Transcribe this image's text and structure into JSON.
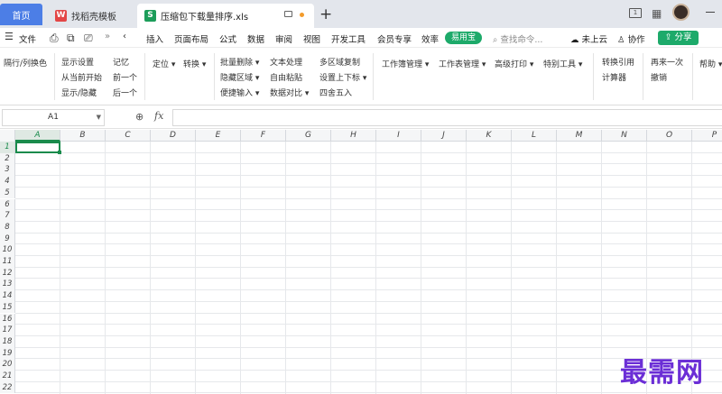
{
  "titlebar": {
    "tabs": [
      {
        "label": "首页"
      },
      {
        "label": "找稻壳模板"
      },
      {
        "label": "压缩包下载量排序.xls"
      }
    ],
    "new_tab": "+"
  },
  "menu": {
    "file": "文件",
    "items": [
      "插入",
      "页面布局",
      "公式",
      "数据",
      "审阅",
      "视图",
      "开发工具",
      "会员专享",
      "效率"
    ],
    "badge": "易用宝",
    "search_placeholder": "查找命令...",
    "cloud": "未上云",
    "collab": "协作",
    "share": "分享"
  },
  "ribbon": {
    "col1": [
      "隔行/列换色"
    ],
    "col2": [
      "显示设置",
      "从当前开始",
      "显示/隐藏"
    ],
    "col3": [
      "记忆",
      "前一个",
      "后一个"
    ],
    "col4": [
      "定位",
      "转换"
    ],
    "col5": [
      "批量删除",
      "隐藏区域",
      "便捷输入"
    ],
    "col6": [
      "文本处理",
      "自由粘贴",
      "数据对比"
    ],
    "col7": [
      "多区域复制",
      "设置上下标",
      "四舍五入"
    ],
    "col8": [
      "工作簿管理",
      "工作表管理",
      "高级打印",
      "特别工具"
    ],
    "col9": [
      "转换引用",
      "计算器"
    ],
    "col10": [
      "再来一次",
      "撤销"
    ],
    "col11": [
      "帮助"
    ]
  },
  "formula": {
    "namebox": "A1",
    "fx": "fx",
    "value": ""
  },
  "grid": {
    "columns": [
      "A",
      "B",
      "C",
      "D",
      "E",
      "F",
      "G",
      "H",
      "I",
      "J",
      "K",
      "L",
      "M",
      "N",
      "O",
      "P"
    ],
    "rows": [
      "1",
      "2",
      "3",
      "4",
      "5",
      "6",
      "7",
      "8",
      "9",
      "10",
      "11",
      "12",
      "13",
      "14",
      "15",
      "16",
      "17",
      "18",
      "19",
      "20",
      "21",
      "22"
    ],
    "selected_cell": "A1"
  },
  "watermark": "最需网",
  "colors": {
    "accent_green": "#1daa6a",
    "home_tab": "#4c7ee6",
    "watermark": "#6b2ed6"
  }
}
